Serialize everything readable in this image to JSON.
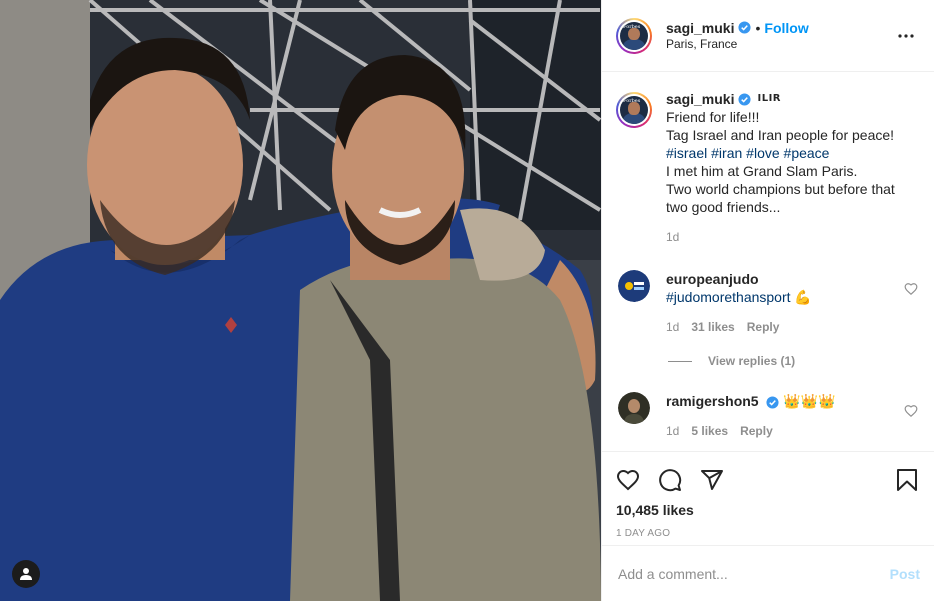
{
  "post": {
    "author": "sagi_muki",
    "follow_label": "Follow",
    "separator": "•",
    "location": "Paris, France",
    "caption_tag": "ILIR",
    "caption_lines": {
      "l1": "Friend for life!!!",
      "l2": "Tag Israel and Iran people for peace!",
      "hashtags": [
        "#israel",
        "#iran",
        "#love",
        "#peace"
      ],
      "l4": "I met him at Grand Slam Paris.",
      "l5": "Two world champions but before that",
      "l6": "two good friends..."
    },
    "caption_age": "1d"
  },
  "comments": [
    {
      "user": "europeanjudo",
      "text": "#judomorethansport",
      "emoji": "💪",
      "age": "1d",
      "likes": "31 likes",
      "reply_label": "Reply",
      "view_replies": "View replies (1)"
    },
    {
      "user": "ramigershon5",
      "text": "👑👑👑",
      "age": "1d",
      "likes": "5 likes",
      "reply_label": "Reply"
    }
  ],
  "stats": {
    "likes": "10,485 likes",
    "time_ago": "1 DAY AGO"
  },
  "composer": {
    "placeholder": "Add a comment...",
    "post_label": "Post"
  },
  "icons": {
    "verified": "verified-badge-icon",
    "more": "more-options-icon",
    "like": "heart-icon",
    "comment": "comment-bubble-icon",
    "share": "paper-plane-icon",
    "save": "bookmark-icon",
    "user_tag": "user-tag-icon"
  },
  "colors": {
    "link_blue": "#0095f6",
    "hashtag": "#00376b",
    "muted": "#8e8e8e",
    "post_disabled": "#b2dffc"
  }
}
